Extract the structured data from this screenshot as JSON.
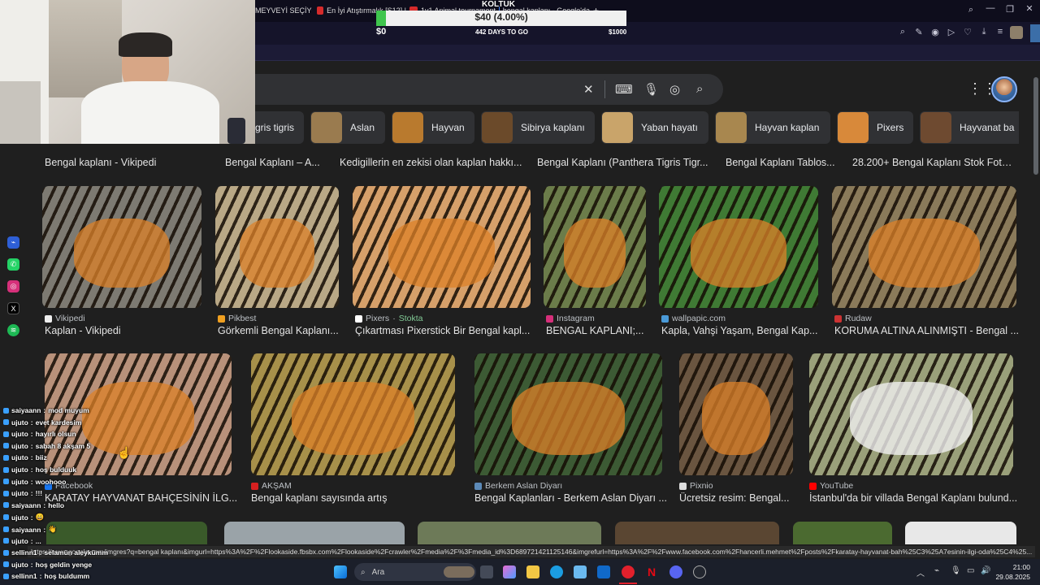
{
  "browser": {
    "tabs": [
      {
        "label": "MEYVEYİ SEÇİYORU"
      },
      {
        "label": "En İyi Atıştırmalık [S12] |"
      },
      {
        "label": "1v1 Animal tournament"
      },
      {
        "label": "bengal kaplanı - Google'da"
      }
    ],
    "new_tab": "+"
  },
  "donation": {
    "title": "KOLTUK",
    "amount": "$40 (4.00%)",
    "progress_percent": 4.0,
    "min": "$0",
    "days": "442 DAYS TO GO",
    "max": "$1000"
  },
  "search": {
    "query": "",
    "clear": "✕"
  },
  "chips": [
    {
      "label": "gris tigris",
      "color": "#8b6a3e"
    },
    {
      "label": "Aslan",
      "color": "#9a7b4f"
    },
    {
      "label": "Hayvan",
      "color": "#b97a2e"
    },
    {
      "label": "Sibirya kaplanı",
      "color": "#6b4a2a"
    },
    {
      "label": "Yaban hayatı",
      "color": "#c9a46a"
    },
    {
      "label": "Hayvan kaplan",
      "color": "#a8874f"
    },
    {
      "label": "Pixers",
      "color": "#d8893a"
    },
    {
      "label": "Hayvanat ba",
      "color": "#6e4a30"
    }
  ],
  "row0_captions": [
    "Bengal kaplanı - Vikipedi",
    "Bengal Kaplanı – A...",
    "Kedigillerin en zekisi olan kaplan hakkı...",
    "Bengal Kaplanı (Panthera Tigris Tigr...",
    "Bengal Kaplanı Tablos...",
    "28.200+ Bengal Kaplanı Stok Foto..."
  ],
  "row1": [
    {
      "source": "Vikipedi",
      "caption": "Kaplan - Vikipedi",
      "fav": "#eeeeee",
      "bg": "#7d7a72"
    },
    {
      "source": "Pikbest",
      "caption": "Görkemli Bengal Kaplanı...",
      "fav": "#f0a020",
      "bg": "#b9a886"
    },
    {
      "source": "Pixers",
      "badge": "Stokta",
      "caption": "Çıkartması Pixerstick Bir Bengal kapl...",
      "fav": "#ffffff",
      "bg": "#d6a06a"
    },
    {
      "source": "Instagram",
      "caption": "BENGAL KAPLANI;...",
      "fav": "#d62f7a",
      "bg": "#6b7c4a"
    },
    {
      "source": "wallpapic.com",
      "caption": "Kapla, Vahşi Yaşam, Bengal Kap...",
      "fav": "#4a9ad8",
      "bg": "#3f7a34"
    },
    {
      "source": "Rudaw",
      "caption": "KORUMA ALTINA ALINMIŞTI - Bengal ...",
      "fav": "#cc3333",
      "bg": "#8a7a5a"
    }
  ],
  "row2": [
    {
      "source": "Facebook",
      "caption": "KARATAY HAYVANAT BAHÇESİNİN İLG...",
      "fav": "#1877f2",
      "bg": "#b8917a"
    },
    {
      "source": "AKŞAM",
      "caption": "Bengal kaplanı sayısında artış",
      "fav": "#d62020",
      "bg": "#a7904a"
    },
    {
      "source": "Berkem Aslan Diyarı",
      "caption": "Bengal Kaplanları - Berkem Aslan Diyarı ...",
      "fav": "#5c8ab8",
      "bg": "#3c5a34"
    },
    {
      "source": "Pixnio",
      "caption": "Ücretsiz resim: Bengal...",
      "fav": "#dddddd",
      "bg": "#6a5540"
    },
    {
      "source": "YouTube",
      "caption": "İstanbul'da bir villada Bengal Kaplanı bulund...",
      "fav": "#ff0000",
      "bg": "#9aa07a"
    }
  ],
  "chat": [
    {
      "user": "saiyaann",
      "msg": "mod muyum"
    },
    {
      "user": "ujuto",
      "msg": "evet kardesim"
    },
    {
      "user": "ujuto",
      "msg": "hayırlı olsun"
    },
    {
      "user": "ujuto",
      "msg": "sabah 8 akşam 5"
    },
    {
      "user": "ujuto",
      "msg": "biiz"
    },
    {
      "user": "ujuto",
      "msg": "hoş bulduuk"
    },
    {
      "user": "ujuto",
      "msg": "woohooo"
    },
    {
      "user": "ujuto",
      "msg": "!!!"
    },
    {
      "user": "saiyaann",
      "msg": "hello"
    },
    {
      "user": "ujuto",
      "msg": "😄"
    },
    {
      "user": "saiyaann",
      "msg": "👋"
    },
    {
      "user": "ujuto",
      "msg": "..."
    },
    {
      "user": "sellinn1",
      "msg": "selamün aleykümm"
    },
    {
      "user": "ujuto",
      "msg": "hoş geldin yenge"
    },
    {
      "user": "sellinn1",
      "msg": "hoş buldumm"
    }
  ],
  "status_url": "https://www.google.com/imgres?q=bengal kaplanı&imgurl=https%3A%2F%2Flookaside.fbsbx.com%2Flookaside%2Fcrawler%2Fmedia%2F%3Fmedia_id%3D689721421125146&imgrefurl=https%3A%2F%2Fwww.facebook.com%2Fhancerli.mehmet%2Fposts%2Fkaratay-hayvanat-bah%25C3%25A7esinin-ilgi-oda%25C4%25...",
  "taskbar": {
    "search_placeholder": "Ara",
    "time": "21:00",
    "date": "29.08.2025"
  },
  "colors": {
    "accent": "#8ab4f8",
    "page_bg": "#1f1f1f",
    "chip_bg": "#303134"
  }
}
